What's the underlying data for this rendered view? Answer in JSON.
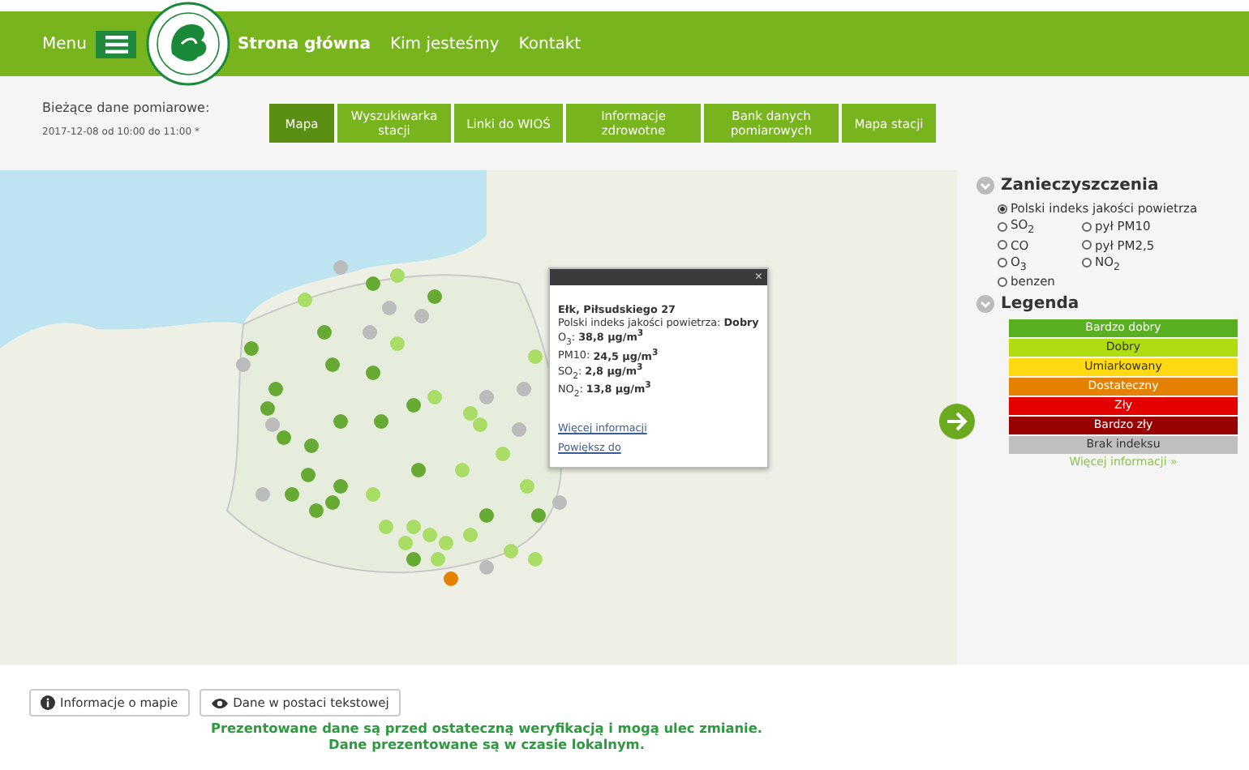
{
  "header": {
    "menu_label": "Menu",
    "nav": [
      {
        "label": "Strona główna",
        "selected": true
      },
      {
        "label": "Kim jesteśmy",
        "selected": false
      },
      {
        "label": "Kontakt",
        "selected": false
      }
    ]
  },
  "data_info": {
    "label": "Bieżące dane pomiarowe:",
    "period": "2017-12-08 od 10:00 do 11:00 *"
  },
  "tabs": [
    {
      "label": "Mapa",
      "selected": true
    },
    {
      "label": "Wyszukiwarka stacji",
      "selected": false
    },
    {
      "label": "Linki do WIOŚ",
      "selected": false
    },
    {
      "label": "Informacje zdrowotne",
      "selected": false
    },
    {
      "label": "Bank danych pomiarowych",
      "selected": false
    },
    {
      "label": "Mapa stacji",
      "selected": false
    }
  ],
  "popup": {
    "title": "Ełk, Piłsudskiego 27",
    "lines": [
      "Polski indeks jakości powietrza: **Dobry**",
      "O$_{3}$: **38,8 µg/m$^{3}$**",
      "PM10: **24,5 µg/m$^{3}$**",
      "SO$_{2}$: **2,8 µg/m$^{3}$**",
      "NO$_{2}$: **13,8 µg/m$^{3}$**"
    ],
    "links": [
      "Więcej informacji",
      "Powiększ do"
    ],
    "close": "×"
  },
  "pollutants": {
    "title": "Zanieczyszczenia",
    "options": [
      {
        "label": "Polski indeks jakości powietrza",
        "selected": true,
        "kind": "wide"
      },
      {
        "label": "SO$_{2}$",
        "selected": false,
        "kind": "half"
      },
      {
        "label": "pył PM10",
        "selected": false,
        "kind": "half"
      },
      {
        "label": "CO",
        "selected": false,
        "kind": "half"
      },
      {
        "label": "pył PM2,5",
        "selected": false,
        "kind": "half"
      },
      {
        "label": "O$_{3}$",
        "selected": false,
        "kind": "half"
      },
      {
        "label": "NO$_{2}$",
        "selected": false,
        "kind": "half"
      },
      {
        "label": "benzen",
        "selected": false,
        "kind": "half"
      }
    ]
  },
  "legend": {
    "title": "Legenda",
    "items": [
      {
        "label": "Bardzo dobry",
        "color": "#58b020"
      },
      {
        "label": "Dobry",
        "color": "#b0dd10"
      },
      {
        "label": "Umiarkowany",
        "color": "#ffd911"
      },
      {
        "label": "Dostateczny",
        "color": "#e58100"
      },
      {
        "label": "Zły",
        "color": "#e50000"
      },
      {
        "label": "Bardzo zły",
        "color": "#990000"
      },
      {
        "label": "Brak indeksu",
        "color": "#bfbfbf"
      }
    ],
    "more": "Więcej informacji »"
  },
  "buttons": [
    "Informacje o mapie",
    "Dane w postaci tekstowej"
  ],
  "notice": [
    "Prezentowane dane są przed ostateczną weryfikacją i mogą ulec zmianie.",
    "Dane prezentowane są w czasie lokalnym."
  ]
}
